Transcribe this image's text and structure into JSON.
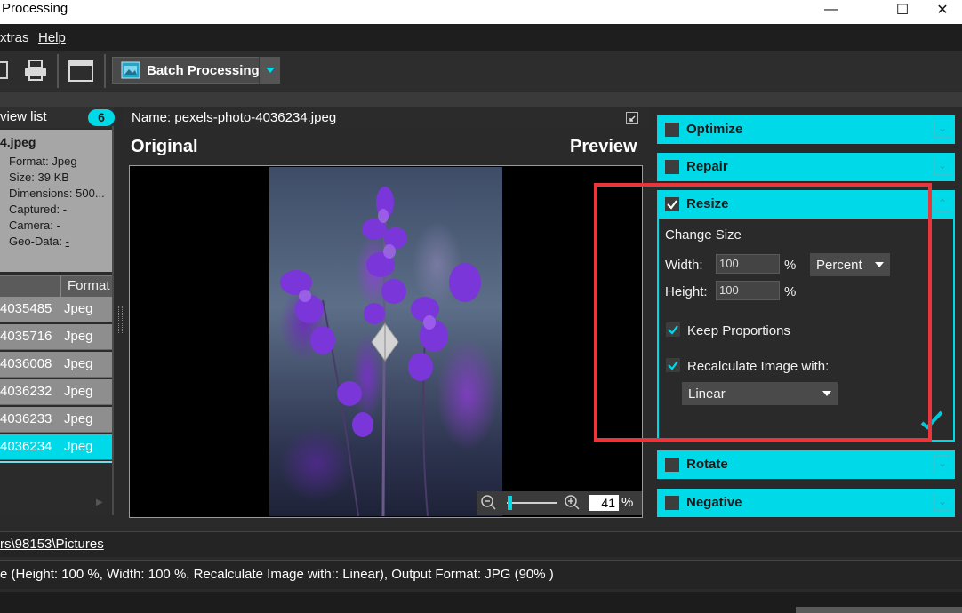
{
  "window": {
    "title": "Processing",
    "controls": [
      "—",
      "☐",
      "✕"
    ]
  },
  "menu": {
    "items": [
      "xtras",
      "Help"
    ]
  },
  "toolbar": {
    "batch_label": "Batch Processing"
  },
  "left_panel": {
    "title": "view list",
    "count": "6",
    "file_name": "4.jpeg",
    "info": {
      "format": "Format: Jpeg",
      "size": "Size: 39 KB",
      "dimensions": "Dimensions: 500...",
      "captured": "Captured: -",
      "camera": "Camera: -",
      "geo": "Geo-Data: ",
      "geo_link": "-"
    },
    "column_header": "Format",
    "rows": [
      {
        "name": "4035485",
        "format": "Jpeg"
      },
      {
        "name": "4035716",
        "format": "Jpeg"
      },
      {
        "name": "4036008",
        "format": "Jpeg"
      },
      {
        "name": "4036232",
        "format": "Jpeg"
      },
      {
        "name": "4036233",
        "format": "Jpeg"
      },
      {
        "name": "4036234",
        "format": "Jpeg"
      }
    ]
  },
  "center": {
    "name_label": "Name: pexels-photo-4036234.jpeg",
    "original_label": "Original",
    "preview_label": "Preview",
    "zoom_value": "41",
    "zoom_unit": "%",
    "zoom_level": 0.06
  },
  "right_panel": {
    "optimize": "Optimize",
    "repair": "Repair",
    "resize": "Resize",
    "change_size": "Change Size",
    "width_label": "Width:",
    "width_value": "100",
    "height_label": "Height:",
    "height_value": "100",
    "percent_sign": "%",
    "unit_dropdown": "Percent",
    "keep_proportions": "Keep Proportions",
    "recalculate": "Recalculate Image with:",
    "method_dropdown": "Linear",
    "rotate": "Rotate",
    "negative": "Negative"
  },
  "status": {
    "path": "rs\\98153\\Pictures",
    "summary": "e (Height: 100 %, Width: 100 %, Recalculate Image with:: Linear), Output Format: JPG (90% )"
  },
  "colors": {
    "accent": "#00d9e8",
    "highlight_box": "#e8363b"
  }
}
